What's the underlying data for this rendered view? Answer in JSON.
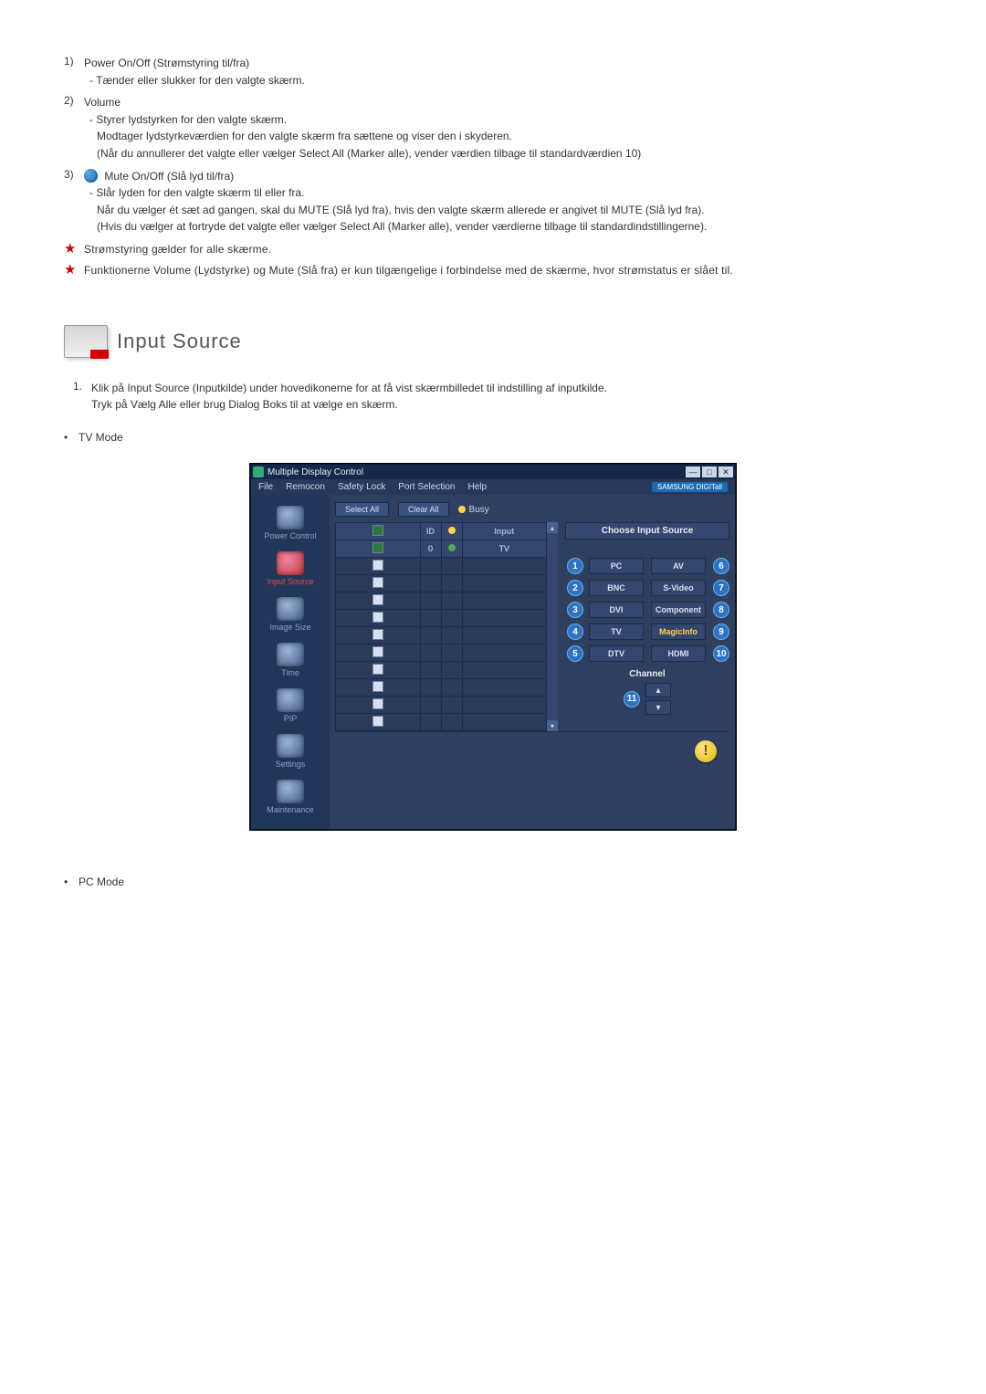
{
  "items": [
    {
      "num": "1)",
      "title": "Power On/Off (Strømstyring til/fra)",
      "lines": [
        "- Tænder eller slukker for den valgte skærm."
      ]
    },
    {
      "num": "2)",
      "title": "Volume",
      "lines": [
        "- Styrer lydstyrken for den valgte skærm.",
        "Modtager lydstyrkeværdien for den valgte skærm fra sættene og viser den i skyderen.",
        "(Når du annullerer det valgte eller vælger Select All (Marker alle), vender værdien tilbage til standardværdien 10)"
      ]
    },
    {
      "num": "3)",
      "icon": true,
      "title": "Mute On/Off (Slå lyd til/fra)",
      "lines": [
        "- Slår lyden for den valgte skærm til eller fra.",
        "Når du vælger ét sæt ad gangen, skal du MUTE (Slå lyd fra), hvis den valgte skærm allerede er angivet til MUTE (Slå lyd fra).",
        "(Hvis du vælger at fortryde det valgte eller vælger Select All (Marker alle), vender værdierne tilbage til standardindstillingerne)."
      ]
    }
  ],
  "stars": [
    "Strømstyring gælder for alle skærme.",
    "Funktionerne Volume (Lydstyrke) og Mute (Slå fra) er kun tilgængelige i forbindelse med de skærme, hvor strømstatus er slået til."
  ],
  "section_title": "Input Source",
  "intro": {
    "num": "1.",
    "line1": "Klik på Input Source (Inputkilde) under hovedikonerne for at få vist skærmbilledet til indstilling af inputkilde.",
    "line2": "Tryk på Vælg Alle eller brug Dialog Boks til at vælge en skærm."
  },
  "mode_bullets": {
    "tv": "TV Mode",
    "pc": "PC Mode"
  },
  "app": {
    "title": "Multiple Display Control",
    "window_buttons": [
      "—",
      "□",
      "✕"
    ],
    "menu": [
      "File",
      "Remocon",
      "Safety Lock",
      "Port Selection",
      "Help"
    ],
    "brand": "SAMSUNG DIGITall",
    "sidebar": [
      {
        "label": "Power Control"
      },
      {
        "label": "Input Source"
      },
      {
        "label": "Image Size"
      },
      {
        "label": "Time"
      },
      {
        "label": "PIP"
      },
      {
        "label": "Settings"
      },
      {
        "label": "Maintenance"
      }
    ],
    "toolbar": {
      "select_all": "Select All",
      "clear_all": "Clear All",
      "busy": "Busy"
    },
    "grid": {
      "headers": [
        "",
        "ID",
        "",
        "Input"
      ],
      "row0": {
        "id": "0",
        "input": "TV"
      },
      "blank_rows": 10
    },
    "right": {
      "title": "Choose Input Source",
      "sources_left": [
        "PC",
        "BNC",
        "DVI",
        "TV",
        "DTV"
      ],
      "sources_right": [
        "AV",
        "S-Video",
        "Component",
        "MagicInfo",
        "HDMI"
      ],
      "nums_left": [
        "1",
        "2",
        "3",
        "4",
        "5"
      ],
      "nums_right": [
        "6",
        "7",
        "8",
        "9",
        "10"
      ],
      "channel_label": "Channel",
      "channel_num": "11"
    }
  }
}
